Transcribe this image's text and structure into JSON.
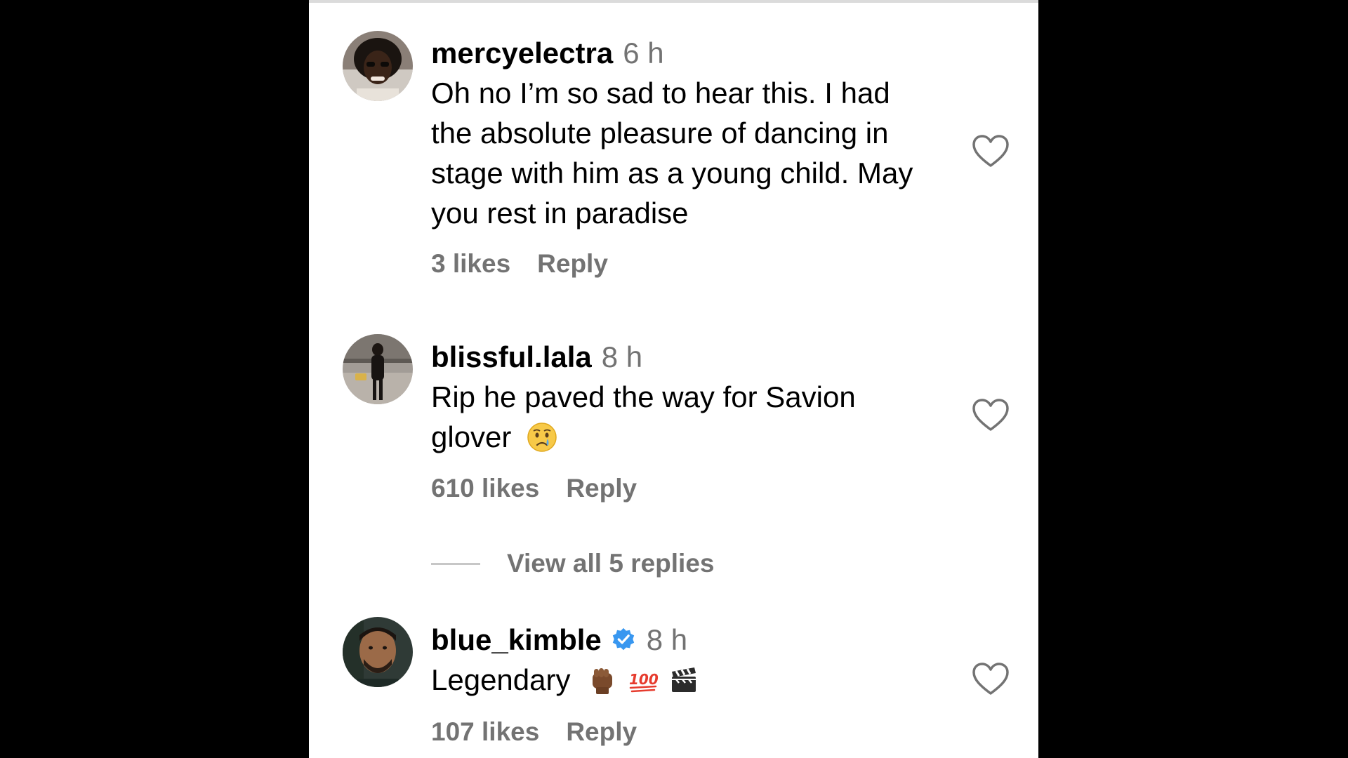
{
  "comments": [
    {
      "username": "mercyelectra",
      "time": "6 h",
      "text_lines": [
        "Oh no I’m so sad to hear this. I had",
        "the absolute pleasure of dancing in",
        "stage with him as a young child. May",
        "you rest in paradise"
      ],
      "likes": "3 likes",
      "reply_label": "Reply",
      "verified": false
    },
    {
      "username": "blissful.lala",
      "time": "8 h",
      "text_lines": [
        "Rip he paved the way for Savion",
        "glover"
      ],
      "emoji": "crying-face-emoji",
      "likes": "610 likes",
      "reply_label": "Reply",
      "verified": false,
      "view_replies": "View all 5 replies"
    },
    {
      "username": "blue_kimble",
      "time": "8 h",
      "text_lines": [
        "Legendary"
      ],
      "emojis": [
        "raised-fist-emoji",
        "hundred-points-emoji",
        "clapper-board-emoji"
      ],
      "likes": "107 likes",
      "reply_label": "Reply",
      "verified": true
    }
  ],
  "colors": {
    "background": "#000000",
    "panel": "#ffffff",
    "secondary_text": "#737373",
    "verified_blue": "#3897f0"
  }
}
